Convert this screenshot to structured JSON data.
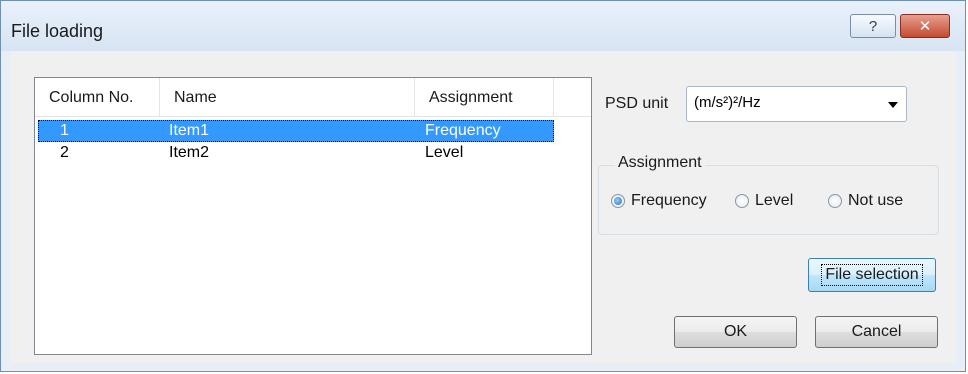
{
  "window": {
    "title": "File loading",
    "help_label": "?",
    "close_label": "✕"
  },
  "list": {
    "columns": [
      "Column No.",
      "Name",
      "Assignment"
    ],
    "rows": [
      {
        "col_no": "1",
        "name": "Item1",
        "assignment": "Frequency",
        "selected": true
      },
      {
        "col_no": "2",
        "name": "Item2",
        "assignment": "Level",
        "selected": false
      }
    ]
  },
  "psd": {
    "label": "PSD unit",
    "value": "(m/s²)²/Hz"
  },
  "assignment": {
    "legend": "Assignment",
    "options": [
      "Frequency",
      "Level",
      "Not use"
    ],
    "selected": "Frequency"
  },
  "buttons": {
    "file_selection": "File selection",
    "ok": "OK",
    "cancel": "Cancel"
  }
}
